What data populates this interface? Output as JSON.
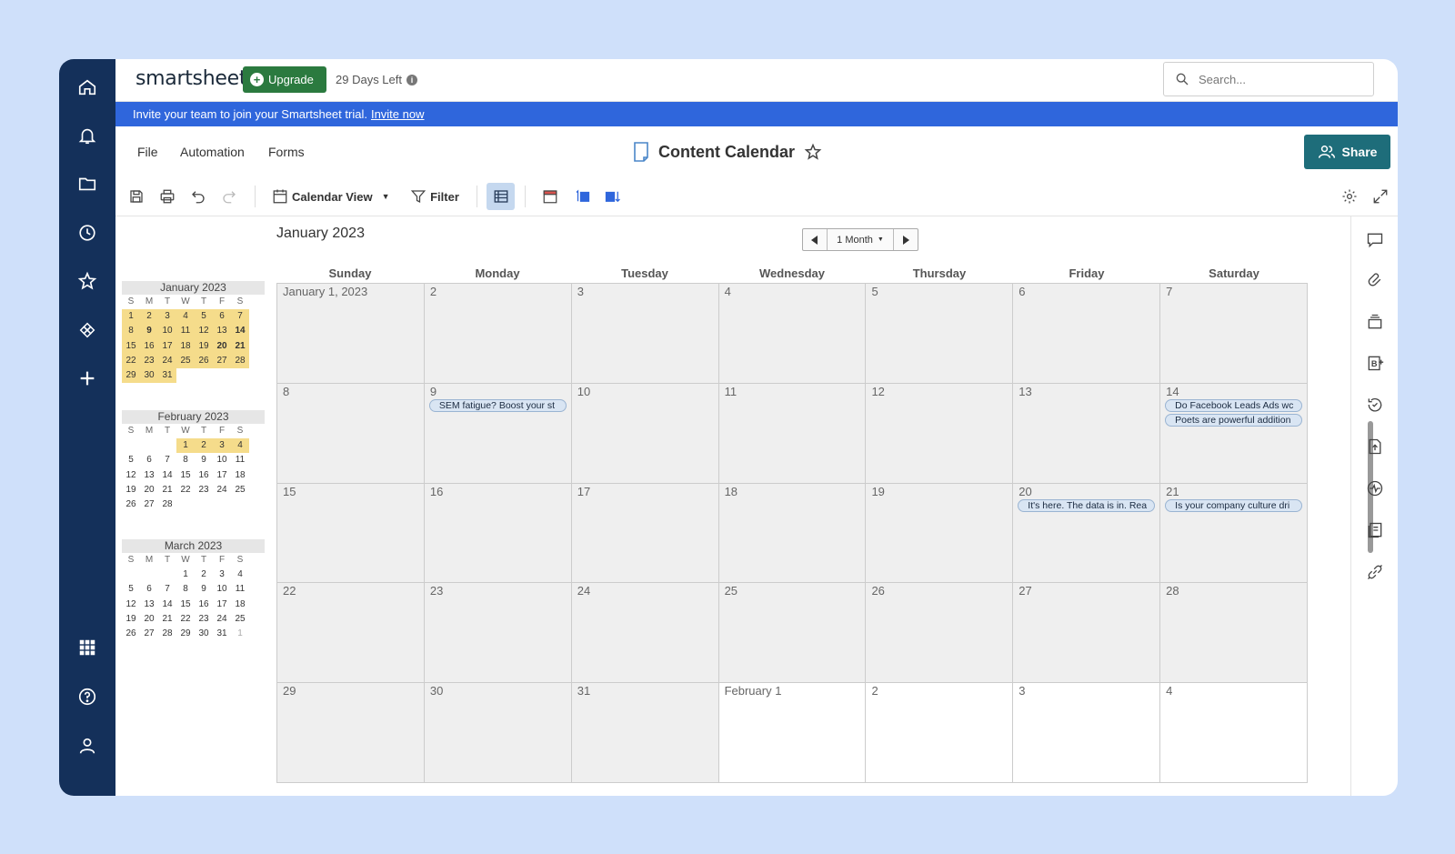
{
  "topbar": {
    "logo": "smartsheet",
    "upgrade_label": "Upgrade",
    "trial_days": "29 Days Left",
    "search_placeholder": "Search..."
  },
  "banner": {
    "text": "Invite your team to join your Smartsheet trial.",
    "link": "Invite now"
  },
  "menu": {
    "file": "File",
    "automation": "Automation",
    "forms": "Forms"
  },
  "document": {
    "title": "Content Calendar"
  },
  "share_label": "Share",
  "toolbar": {
    "view_label": "Calendar View",
    "filter_label": "Filter"
  },
  "calendar": {
    "month_title": "January 2023",
    "period_select": "1 Month",
    "weekdays": [
      "Sunday",
      "Monday",
      "Tuesday",
      "Wednesday",
      "Thursday",
      "Friday",
      "Saturday"
    ],
    "weeks": [
      [
        "January 1, 2023",
        "2",
        "3",
        "4",
        "5",
        "6",
        "7"
      ],
      [
        "8",
        "9",
        "10",
        "11",
        "12",
        "13",
        "14"
      ],
      [
        "15",
        "16",
        "17",
        "18",
        "19",
        "20",
        "21"
      ],
      [
        "22",
        "23",
        "24",
        "25",
        "26",
        "27",
        "28"
      ],
      [
        "29",
        "30",
        "31",
        "February 1",
        "2",
        "3",
        "4"
      ]
    ],
    "events": [
      {
        "week": 1,
        "day": 1,
        "slot": 0,
        "text": "SEM fatigue? Boost your st"
      },
      {
        "week": 1,
        "day": 6,
        "slot": 0,
        "text": "Do Facebook Leads Ads wc"
      },
      {
        "week": 1,
        "day": 6,
        "slot": 1,
        "text": "Poets are powerful addition"
      },
      {
        "week": 2,
        "day": 5,
        "slot": 0,
        "text": "It's here. The data is in. Rea"
      },
      {
        "week": 2,
        "day": 6,
        "slot": 0,
        "text": "Is your company culture dri"
      }
    ]
  },
  "mini_calendars": {
    "weekday_letters": [
      "S",
      "M",
      "T",
      "W",
      "T",
      "F",
      "S"
    ],
    "months": [
      {
        "title": "January 2023",
        "weeks": [
          [
            "1",
            "2",
            "3",
            "4",
            "5",
            "6",
            "7"
          ],
          [
            "8",
            "9",
            "10",
            "11",
            "12",
            "13",
            "14"
          ],
          [
            "15",
            "16",
            "17",
            "18",
            "19",
            "20",
            "21"
          ],
          [
            "22",
            "23",
            "24",
            "25",
            "26",
            "27",
            "28"
          ],
          [
            "29",
            "30",
            "31",
            "",
            "",
            "",
            ""
          ]
        ],
        "highlight": [
          [
            1,
            1,
            1,
            1,
            1,
            1,
            1
          ],
          [
            1,
            1,
            1,
            1,
            1,
            1,
            1
          ],
          [
            1,
            1,
            1,
            1,
            1,
            1,
            1
          ],
          [
            1,
            1,
            1,
            1,
            1,
            1,
            1
          ],
          [
            1,
            1,
            1,
            0,
            0,
            0,
            0
          ]
        ],
        "bold": [
          "9",
          "14",
          "20",
          "21"
        ]
      },
      {
        "title": "February 2023",
        "weeks": [
          [
            "",
            "",
            "",
            "1",
            "2",
            "3",
            "4"
          ],
          [
            "5",
            "6",
            "7",
            "8",
            "9",
            "10",
            "11"
          ],
          [
            "12",
            "13",
            "14",
            "15",
            "16",
            "17",
            "18"
          ],
          [
            "19",
            "20",
            "21",
            "22",
            "23",
            "24",
            "25"
          ],
          [
            "26",
            "27",
            "28",
            "",
            "",
            "",
            ""
          ]
        ],
        "highlight": [
          [
            0,
            0,
            0,
            1,
            1,
            1,
            1
          ],
          [
            0,
            0,
            0,
            0,
            0,
            0,
            0
          ],
          [
            0,
            0,
            0,
            0,
            0,
            0,
            0
          ],
          [
            0,
            0,
            0,
            0,
            0,
            0,
            0
          ],
          [
            0,
            0,
            0,
            0,
            0,
            0,
            0
          ]
        ],
        "bold": []
      },
      {
        "title": "March 2023",
        "weeks": [
          [
            "",
            "",
            "",
            "1",
            "2",
            "3",
            "4"
          ],
          [
            "5",
            "6",
            "7",
            "8",
            "9",
            "10",
            "11"
          ],
          [
            "12",
            "13",
            "14",
            "15",
            "16",
            "17",
            "18"
          ],
          [
            "19",
            "20",
            "21",
            "22",
            "23",
            "24",
            "25"
          ],
          [
            "26",
            "27",
            "28",
            "29",
            "30",
            "31",
            "1"
          ]
        ],
        "highlight": [
          [
            0,
            0,
            0,
            0,
            0,
            0,
            0
          ],
          [
            0,
            0,
            0,
            0,
            0,
            0,
            0
          ],
          [
            0,
            0,
            0,
            0,
            0,
            0,
            0
          ],
          [
            0,
            0,
            0,
            0,
            0,
            0,
            0
          ],
          [
            0,
            0,
            0,
            0,
            0,
            0,
            0
          ]
        ],
        "bold": []
      }
    ]
  },
  "icons": {
    "rail": [
      "home-icon",
      "bell-icon",
      "folder-icon",
      "clock-icon",
      "star-icon",
      "solutions-icon",
      "plus-icon",
      "apps-grid-icon",
      "help-icon",
      "user-icon"
    ],
    "side_panel": [
      "comment-icon",
      "attachment-icon",
      "proofing-icon",
      "brandfolder-icon",
      "activity-icon",
      "upload-icon",
      "pulse-icon",
      "summary-icon",
      "connections-icon"
    ]
  },
  "colors": {
    "rail": "#14305a",
    "banner": "#2f66dc",
    "upgrade": "#2b7a3f",
    "share": "#1e6d7a",
    "mini_highlight": "#f5dc8b",
    "event_bg": "#d9e5f3"
  }
}
